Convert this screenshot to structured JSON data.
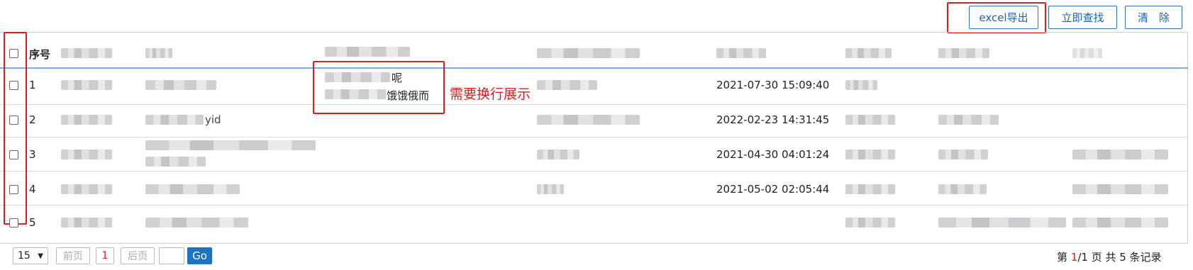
{
  "toolbar": {
    "export_label": "excel导出",
    "search_label": "立即查找",
    "clear_label": "清　除"
  },
  "table": {
    "header_seq": "序号",
    "rows": [
      {
        "seq": "1",
        "c3_line1_tail": "呢",
        "c3_line2_tail": "饿饿俄而",
        "time": "2021-07-30 15:09:40"
      },
      {
        "seq": "2",
        "c2_tail": "yid",
        "time": "2022-02-23 14:31:45"
      },
      {
        "seq": "3",
        "time": "2021-04-30 04:01:24"
      },
      {
        "seq": "4",
        "time": "2021-05-02 02:05:44"
      },
      {
        "seq": "5",
        "time": ""
      }
    ]
  },
  "annotation": {
    "note": "需要换行展示",
    "color": "#e01d1d"
  },
  "pagination": {
    "page_size": "15",
    "prev": "前页",
    "current_page": "1",
    "next": "后页",
    "jump_value": "",
    "go": "Go",
    "summary_prefix": "第 ",
    "summary_page": "1",
    "summary_mid": "/1 页   共 5 条记录"
  }
}
